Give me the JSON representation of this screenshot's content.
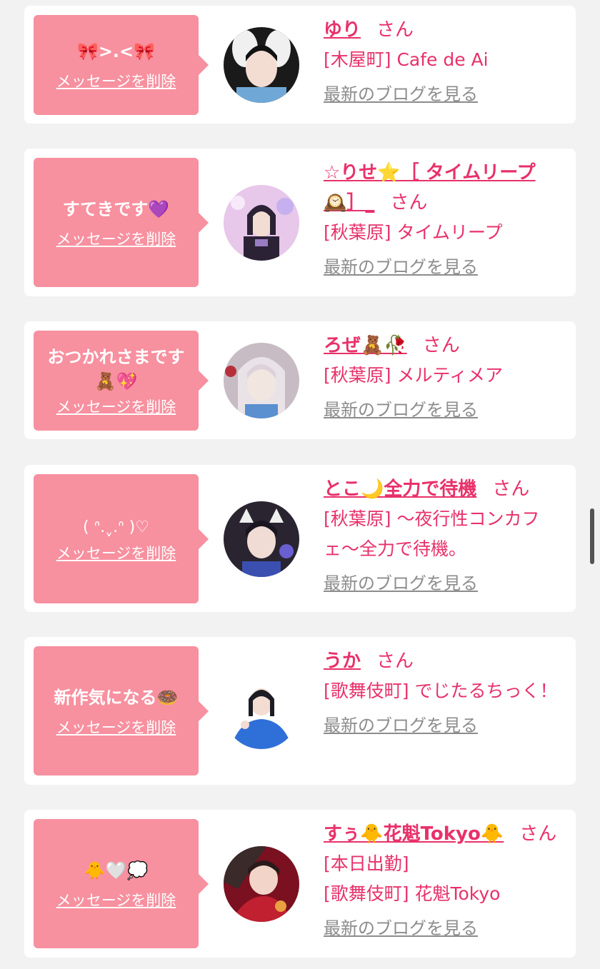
{
  "delete_label": "メッセージを削除",
  "blog_label": "最新のブログを見る",
  "cards": [
    {
      "message": "🎀>.<🎀",
      "name": "ゆり",
      "san": "さん",
      "shop": "[木屋町] Cafe de Ai",
      "avatar_colors": [
        "#1a1a1a",
        "#f0f0f0",
        "#6fa8d6"
      ]
    },
    {
      "message": "すてきです💜",
      "name": "☆りせ⭐️［ タイムリープ🕰️］_",
      "san": "さん",
      "shop": "[秋葉原] タイムリープ",
      "avatar_colors": [
        "#e7c7ea",
        "#2b2236",
        "#9a7cc2"
      ]
    },
    {
      "message": "おつかれさまです🧸💖",
      "name": "ろぜ🧸🥀",
      "san": "さん",
      "shop": "[秋葉原] メルティメア",
      "avatar_colors": [
        "#d8d3d8",
        "#f1e6e0",
        "#5a8fd0"
      ]
    },
    {
      "message": "( ᐢ.ˬ.ᐢ )♡",
      "name": "とこ🌙全力で待機",
      "san": "さん",
      "shop": "[秋葉原] 〜夜行性コンカフェ〜全力で待機。",
      "avatar_colors": [
        "#2a2430",
        "#f0dcd4",
        "#3a4fb0"
      ]
    },
    {
      "message": "新作気になる🍩",
      "name": "うか",
      "san": "さん",
      "shop": "[歌舞伎町] でじたるちっく！",
      "avatar_colors": [
        "#ffffff",
        "#1c1c24",
        "#2f6fd8"
      ]
    },
    {
      "message": "🐥🤍💭",
      "name": "すぅ🐥花魁Tokyo🐥",
      "san": "さん",
      "shop": "[本日出勤]\n[歌舞伎町] 花魁Tokyo",
      "avatar_colors": [
        "#7a1020",
        "#f3d4c8",
        "#c02030"
      ]
    }
  ]
}
